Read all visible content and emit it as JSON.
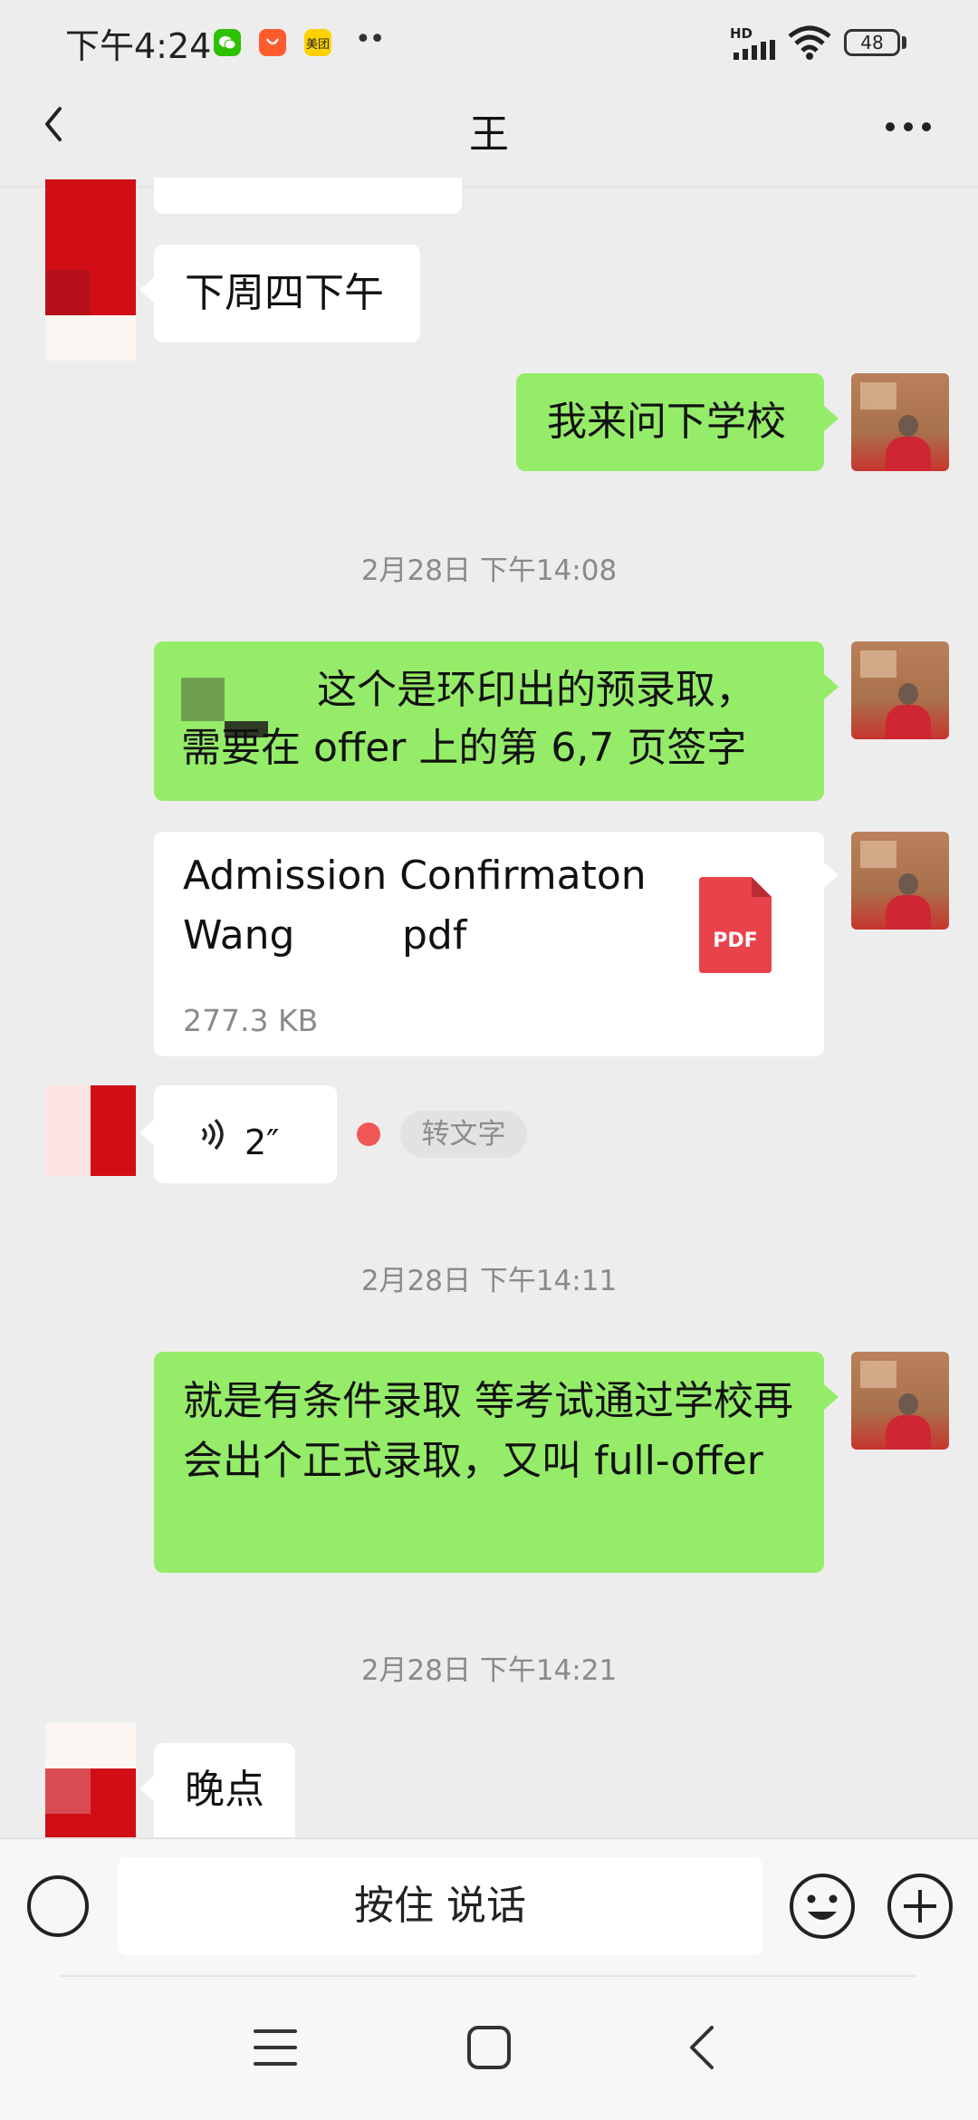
{
  "status_bar": {
    "time": "下午4:24",
    "apps": [
      {
        "name": "wechat-app-icon",
        "label": "",
        "color": "#2dc100"
      },
      {
        "name": "taobao-app-icon",
        "label": "",
        "color": "#ff5b2e"
      },
      {
        "name": "meituan-app-icon",
        "label": "美团",
        "color": "#ffd100"
      }
    ],
    "more_indicator": "••",
    "network_label": "HD",
    "battery": "48"
  },
  "header": {
    "title": "王",
    "back_icon": "chevron-left-icon",
    "more_icon": "ellipsis-icon"
  },
  "messages": {
    "m1": {
      "text": "下周四下午",
      "sender": "other"
    },
    "m2": {
      "text": "我来问下学校",
      "sender": "self"
    },
    "ts1": "2月28日 下午14:08",
    "m3": {
      "text": "这个是环印出的预录取，需要在 offer 上的第 6,7 页签字",
      "sender": "self"
    },
    "file": {
      "name_line1": "Admission Confirmaton",
      "name_line2_prefix": "Wang",
      "name_line2_suffix": "pdf",
      "size": "277.3 KB",
      "icon_label": "PDF"
    },
    "voice": {
      "duration": "2″",
      "to_text": "转文字"
    },
    "ts2": "2月28日 下午14:11",
    "m4": {
      "text": "就是有条件录取 等考试通过学校再会出个正式录取，又叫 full-offer",
      "sender": "self"
    },
    "ts3": "2月28日 下午14:21",
    "m5": {
      "text": "晚点",
      "sender": "other"
    }
  },
  "input": {
    "hold_to_talk": "按住 说话",
    "emoji_icon": "smiley-icon",
    "plus_icon": "plus-circle-icon"
  },
  "colors": {
    "bubble_self": "#95ec69",
    "bubble_other": "#ffffff",
    "background": "#ededed",
    "unread_dot": "#f25656",
    "pdf_red": "#e8434b"
  }
}
